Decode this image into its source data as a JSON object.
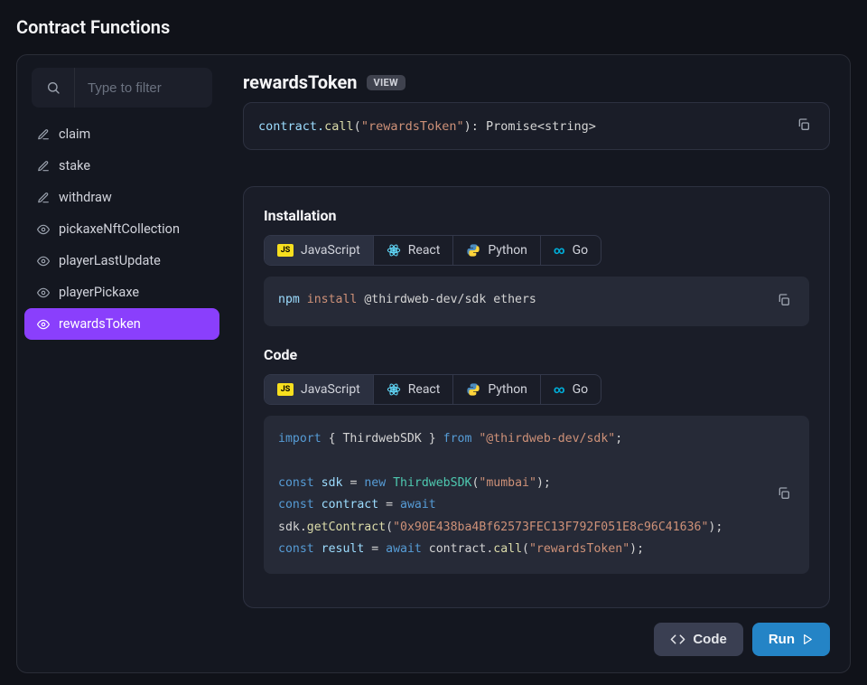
{
  "pageTitle": "Contract Functions",
  "search": {
    "placeholder": "Type to filter"
  },
  "functions": [
    {
      "name": "claim",
      "icon": "pencil"
    },
    {
      "name": "stake",
      "icon": "pencil"
    },
    {
      "name": "withdraw",
      "icon": "pencil"
    },
    {
      "name": "pickaxeNftCollection",
      "icon": "eye"
    },
    {
      "name": "playerLastUpdate",
      "icon": "eye"
    },
    {
      "name": "playerPickaxe",
      "icon": "eye"
    },
    {
      "name": "rewardsToken",
      "icon": "eye",
      "active": true
    }
  ],
  "detail": {
    "name": "rewardsToken",
    "badge": "VIEW",
    "signature": {
      "prefix": "contract.",
      "call": "call",
      "argString": "\"rewardsToken\"",
      "returnType": "Promise<string>"
    }
  },
  "installation": {
    "heading": "Installation",
    "tabs": [
      "JavaScript",
      "React",
      "Python",
      "Go"
    ],
    "activeTab": 0,
    "command": {
      "tool": "npm",
      "verb": "install",
      "packages": "@thirdweb-dev/sdk ethers"
    }
  },
  "code": {
    "heading": "Code",
    "tabs": [
      "JavaScript",
      "React",
      "Python",
      "Go"
    ],
    "activeTab": 0,
    "lines": {
      "import_kw": "import",
      "import_sym": "{ ThirdwebSDK }",
      "from_kw": "from",
      "import_pkg": "\"@thirdweb-dev/sdk\"",
      "const_kw": "const",
      "sdk_ident": "sdk",
      "new_kw": "new",
      "class_name": "ThirdwebSDK",
      "network_str": "\"mumbai\"",
      "contract_ident": "contract",
      "await_kw": "await",
      "getContract_fn": "getContract",
      "address_str": "\"0x90E438ba4Bf62573FEC13F792F051E8c96C41636\"",
      "result_ident": "result",
      "call_fn": "call",
      "fn_name_str": "\"rewardsToken\""
    }
  },
  "footer": {
    "codeBtn": "Code",
    "runBtn": "Run"
  }
}
